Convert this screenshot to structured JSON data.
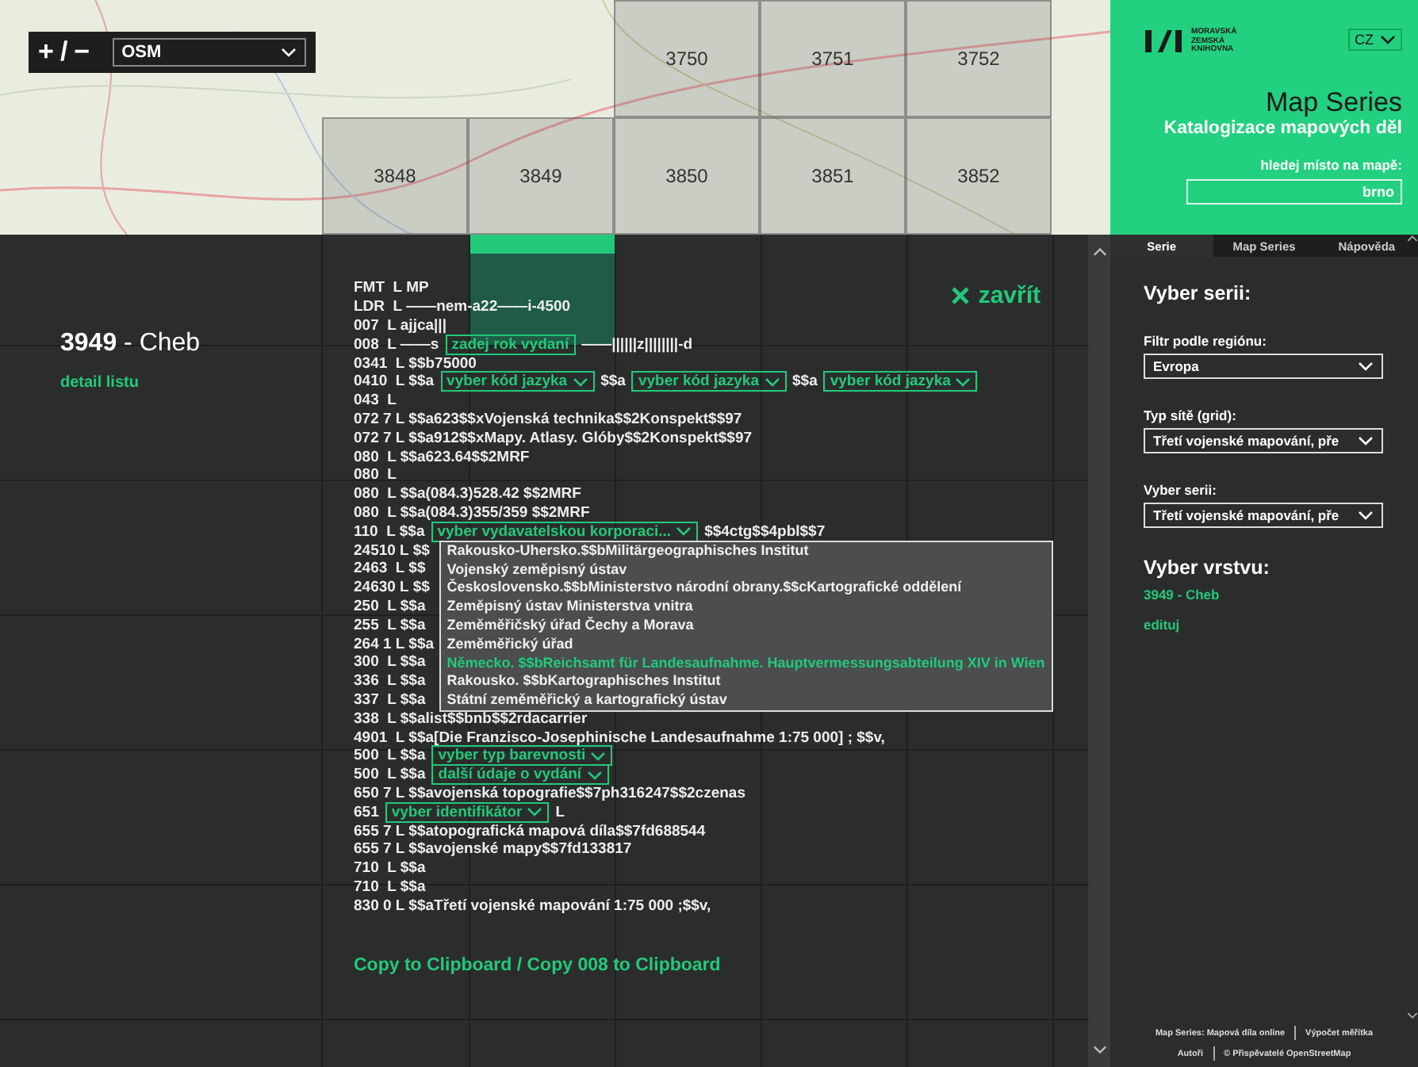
{
  "map": {
    "zoom_plus": "+",
    "zoom_sep": "/",
    "zoom_minus": "−",
    "layer_select": "OSM",
    "grid_rows": [
      [
        "3750",
        "3751",
        "3752"
      ],
      [
        "3848",
        "3849",
        "3850",
        "3851",
        "3852"
      ]
    ]
  },
  "detail": {
    "number": "3949",
    "name": " - Cheb",
    "link": "detail listu",
    "close": "zavřít",
    "lines": [
      {
        "segments": [
          {
            "kind": "text",
            "text": "FMT  L MP"
          }
        ]
      },
      {
        "segments": [
          {
            "kind": "text",
            "text": "LDR  L ——nem-a22——i-4500"
          }
        ]
      },
      {
        "segments": [
          {
            "kind": "text",
            "text": "007  L ajjca|||"
          }
        ]
      },
      {
        "segments": [
          {
            "kind": "text",
            "text": "008  L ——s"
          },
          {
            "kind": "input",
            "text": "zadej rok vydaní"
          },
          {
            "kind": "text",
            "text": "——||||||z||||||||-d"
          }
        ]
      },
      {
        "segments": [
          {
            "kind": "text",
            "text": "0341  L $$b75000"
          }
        ]
      },
      {
        "segments": [
          {
            "kind": "text",
            "text": "0410  L $$a"
          },
          {
            "kind": "select",
            "text": "vyber kód jazyka",
            "open": false
          },
          {
            "kind": "text",
            "text": "$$a"
          },
          {
            "kind": "select",
            "text": "vyber kód jazyka",
            "open": false
          },
          {
            "kind": "text",
            "text": "$$a"
          },
          {
            "kind": "select",
            "text": "vyber kód jazyka",
            "open": false
          }
        ]
      },
      {
        "segments": [
          {
            "kind": "text",
            "text": "043  L"
          }
        ]
      },
      {
        "segments": [
          {
            "kind": "text",
            "text": "072 7 L $$a623$$xVojenská technika$$2Konspekt$$97"
          }
        ]
      },
      {
        "segments": [
          {
            "kind": "text",
            "text": "072 7 L $$a912$$xMapy. Atlasy. Glóby$$2Konspekt$$97"
          }
        ]
      },
      {
        "segments": [
          {
            "kind": "text",
            "text": "080  L $$a623.64$$2MRF"
          }
        ]
      },
      {
        "segments": [
          {
            "kind": "text",
            "text": "080  L"
          }
        ]
      },
      {
        "segments": [
          {
            "kind": "text",
            "text": "080  L $$a(084.3)528.42 $$2MRF"
          }
        ]
      },
      {
        "segments": [
          {
            "kind": "text",
            "text": "080  L $$a(084.3)355/359 $$2MRF"
          }
        ]
      },
      {
        "segments": [
          {
            "kind": "text",
            "text": "110  L $$a"
          },
          {
            "kind": "select",
            "text": "vyber vydavatelskou korporaci...",
            "open": true,
            "options": [
              {
                "text": "Rakousko-Uhersko.$$bMilitärgeographisches Institut",
                "selected": false
              },
              {
                "text": "Vojenský zeměpisný ústav",
                "selected": false
              },
              {
                "text": "Československo.$$bMinisterstvo národní obrany.$$cKartografické oddělení",
                "selected": false
              },
              {
                "text": "Zeměpisný ústav Ministerstva vnitra",
                "selected": false
              },
              {
                "text": "Zeměměřičský úřad Čechy a Morava",
                "selected": false
              },
              {
                "text": "Zeměměřický úřad",
                "selected": false
              },
              {
                "text": "Německo. $$bReichsamt für Landesaufnahme. Hauptvermessungsabteilung XIV in Wien",
                "selected": true
              },
              {
                "text": "Rakousko. $$bKartographisches Institut",
                "selected": false
              },
              {
                "text": "Státní zeměměřický a kartografický ústav",
                "selected": false
              }
            ]
          },
          {
            "kind": "text",
            "text": "$$4ctg$$4pbl$$7"
          }
        ]
      },
      {
        "segments": [
          {
            "kind": "text",
            "text": "24510 L $$"
          }
        ]
      },
      {
        "segments": [
          {
            "kind": "text",
            "text": "2463  L $$"
          }
        ]
      },
      {
        "segments": [
          {
            "kind": "text",
            "text": "24630 L $$"
          }
        ]
      },
      {
        "segments": [
          {
            "kind": "text",
            "text": "250  L $$a"
          }
        ]
      },
      {
        "segments": [
          {
            "kind": "text",
            "text": "255  L $$a"
          }
        ]
      },
      {
        "segments": [
          {
            "kind": "text",
            "text": "264 1 L $$a"
          }
        ]
      },
      {
        "segments": [
          {
            "kind": "text",
            "text": "300  L $$a"
          }
        ]
      },
      {
        "segments": [
          {
            "kind": "text",
            "text": "336  L $$a"
          }
        ]
      },
      {
        "segments": [
          {
            "kind": "text",
            "text": "337  L $$a"
          }
        ]
      },
      {
        "segments": [
          {
            "kind": "text",
            "text": "338  L $$alist$$bnb$$2rdacarrier"
          }
        ]
      },
      {
        "segments": [
          {
            "kind": "text",
            "text": "4901  L $$a[Die Franzisco-Josephinische Landesaufnahme 1:75 000] ; $$v,"
          }
        ]
      },
      {
        "segments": [
          {
            "kind": "text",
            "text": "500  L $$a"
          },
          {
            "kind": "select",
            "text": "vyber typ barevnosti",
            "open": false
          }
        ]
      },
      {
        "segments": [
          {
            "kind": "text",
            "text": "500  L $$a"
          },
          {
            "kind": "select",
            "text": "další údaje o vydání",
            "open": false
          }
        ]
      },
      {
        "segments": [
          {
            "kind": "text",
            "text": "650 7 L $$avojenská topografie$$7ph316247$$2czenas"
          }
        ]
      },
      {
        "segments": [
          {
            "kind": "text",
            "text": "651"
          },
          {
            "kind": "select",
            "text": "vyber identifikátor",
            "open": false
          },
          {
            "kind": "text",
            "text": "L"
          }
        ]
      },
      {
        "segments": [
          {
            "kind": "text",
            "text": "655 7 L $$atopografická mapová díla$$7fd688544"
          }
        ]
      },
      {
        "segments": [
          {
            "kind": "text",
            "text": "655 7 L $$avojenské mapy$$7fd133817"
          }
        ]
      },
      {
        "segments": [
          {
            "kind": "text",
            "text": "710  L $$a"
          }
        ]
      },
      {
        "segments": [
          {
            "kind": "text",
            "text": "710  L $$a"
          }
        ]
      },
      {
        "segments": [
          {
            "kind": "text",
            "text": "830 0 L $$aTřetí vojenské mapování 1:75 000 ;$$v,"
          }
        ]
      }
    ],
    "copy_link": "Copy to Clipboard / Copy 008 to Clipboard"
  },
  "header": {
    "logo_lines": [
      "MORAVSKÁ",
      "ZEMSKÁ",
      "KNIHOVNA"
    ],
    "language": "CZ",
    "title": "Map Series",
    "subtitle": "Katalogizace mapových děl",
    "search_label": "hledej místo na mapě:",
    "search_value": "brno"
  },
  "sidebar": {
    "tabs": [
      {
        "label": "Serie",
        "selected": true
      },
      {
        "label": "Map Series",
        "selected": false
      },
      {
        "label": "Nápověda",
        "selected": false
      }
    ],
    "heading": "Vyber serii:",
    "fields": [
      {
        "label": "Filtr podle regiónu:",
        "value": "Evropa"
      },
      {
        "label": "Typ sítě (grid):",
        "value": "Třetí vojenské mapování, pře"
      },
      {
        "label": "Vyber serii:",
        "value": "Třetí vojenské mapování, pře"
      }
    ],
    "layer_heading": "Vyber vrstvu:",
    "layer": "3949 - Cheb",
    "edit_link": "edituj",
    "footer_links": [
      [
        "Map Series: Mapová díla online",
        "Výpočet měřítka"
      ],
      [
        "Autoři",
        "© Přispěvatelé OpenStreetMap"
      ]
    ]
  }
}
